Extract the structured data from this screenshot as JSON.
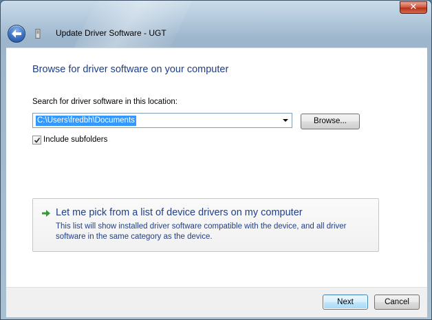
{
  "window": {
    "title": "Update Driver Software - UGT",
    "close_glyph": "✕"
  },
  "icons": {
    "back": "back-arrow-icon",
    "device": "device-icon",
    "close": "close-icon",
    "pick_arrow": "green-arrow-icon",
    "checkmark": "checkmark-icon"
  },
  "content": {
    "heading": "Browse for driver software on your computer",
    "search_label": "Search for driver software in this location:",
    "path_value": "C:\\Users\\fredbh\\Documents",
    "browse_label": "Browse...",
    "include_subfolders_label": "Include subfolders",
    "include_subfolders_checked": true,
    "pick_title": "Let me pick from a list of device drivers on my computer",
    "pick_description": "This list will show installed driver software compatible with the device, and all driver software in the same category as the device."
  },
  "footer": {
    "next_label": "Next",
    "cancel_label": "Cancel"
  },
  "colors": {
    "heading_blue": "#1e3e87",
    "selection_blue": "#3399ff",
    "arrow_green": "#2f9e2f",
    "close_red": "#c7402a"
  }
}
